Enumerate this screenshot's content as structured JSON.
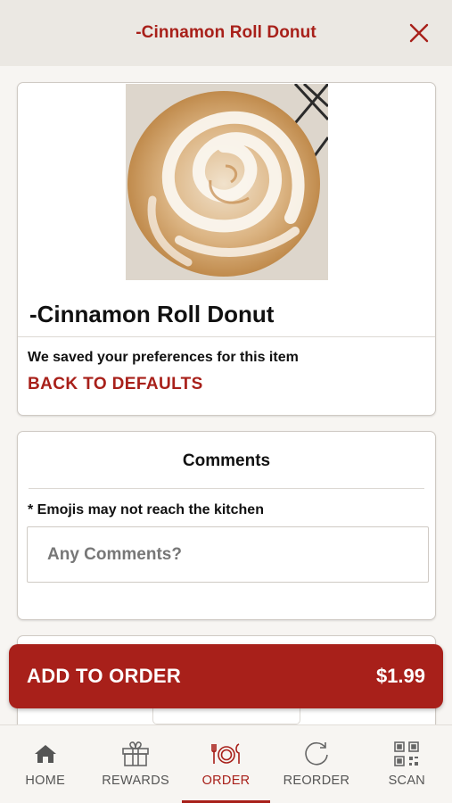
{
  "header": {
    "title": "-Cinnamon Roll Donut"
  },
  "item": {
    "name": "-Cinnamon Roll Donut",
    "preferences_text": "We saved your preferences for this item",
    "back_to_defaults": "BACK TO DEFAULTS"
  },
  "comments": {
    "title": "Comments",
    "note": "* Emojis may not reach the kitchen",
    "placeholder": "Any Comments?"
  },
  "order": {
    "add_label": "ADD TO ORDER",
    "price": "$1.99"
  },
  "nav": {
    "items": [
      {
        "label": "HOME",
        "icon": "home-icon"
      },
      {
        "label": "REWARDS",
        "icon": "gift-icon"
      },
      {
        "label": "ORDER",
        "icon": "plate-utensils-icon",
        "active": true
      },
      {
        "label": "REORDER",
        "icon": "reorder-icon"
      },
      {
        "label": "SCAN",
        "icon": "qr-code-icon"
      }
    ]
  },
  "colors": {
    "accent": "#a8201a",
    "header_bg": "#ebe8e3",
    "page_bg": "#f7f5f2"
  }
}
